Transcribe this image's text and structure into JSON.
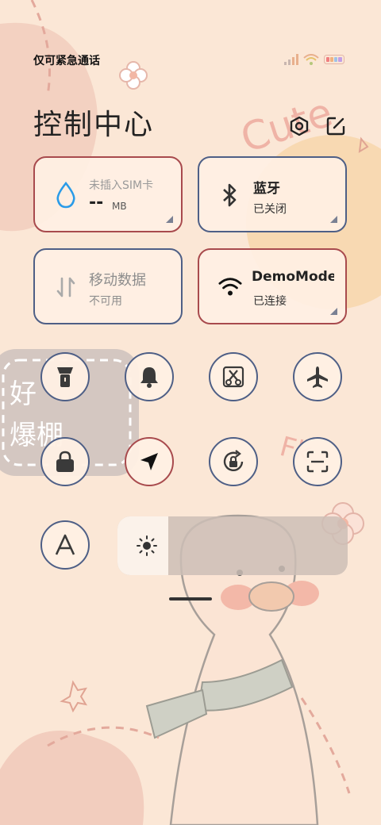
{
  "status_bar": {
    "carrier_text": "仅可紧急通话",
    "icons": [
      "signal-icon",
      "wifi-icon",
      "battery-icon"
    ]
  },
  "header": {
    "title": "控制中心",
    "settings_icon": "settings-hex-icon",
    "edit_icon": "edit-icon"
  },
  "tiles": {
    "data_usage": {
      "label": "未插入SIM卡",
      "value": "--",
      "unit": "MB",
      "icon": "water-drop-icon"
    },
    "bluetooth": {
      "label": "蓝牙",
      "status": "已关闭",
      "icon": "bluetooth-icon"
    },
    "mobile_data": {
      "label": "移动数据",
      "status": "不可用",
      "icon": "data-arrows-icon"
    },
    "wifi": {
      "label": "DemoMode",
      "status": "已连接",
      "icon": "wifi-icon"
    }
  },
  "toggles": [
    {
      "name": "flashlight",
      "icon": "flashlight-icon"
    },
    {
      "name": "ringer",
      "icon": "bell-icon"
    },
    {
      "name": "screenshot",
      "icon": "scissors-icon"
    },
    {
      "name": "airplane",
      "icon": "airplane-icon"
    },
    {
      "name": "lock",
      "icon": "lock-icon"
    },
    {
      "name": "location",
      "icon": "location-arrow-icon"
    },
    {
      "name": "auto-rotate",
      "icon": "rotate-lock-icon"
    },
    {
      "name": "scan",
      "icon": "scan-icon"
    },
    {
      "name": "reading-mode",
      "icon": "font-a-icon"
    }
  ],
  "brightness": {
    "level": 0.22,
    "icon": "sun-icon"
  },
  "wallpaper": {
    "sticker_text_1": "Cute",
    "sticker_text_2": "好",
    "sticker_text_3": "爆棚",
    "sticker_text_4": "Fk"
  }
}
